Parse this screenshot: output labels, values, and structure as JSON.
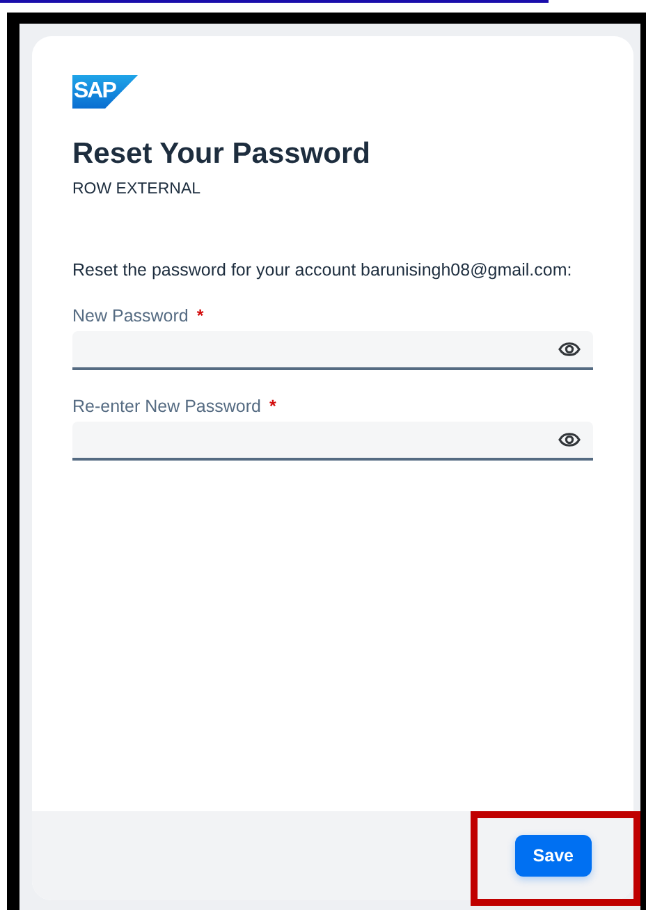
{
  "logo": "SAP",
  "title": "Reset Your Password",
  "subtitle": "ROW EXTERNAL",
  "instruction": "Reset the password for your account barunisingh08@gmail.com:",
  "fields": [
    {
      "label": "New Password",
      "required_mark": "*"
    },
    {
      "label": "Re-enter New Password",
      "required_mark": "*"
    }
  ],
  "buttons": [
    {
      "label": "Save",
      "highlighted": true
    }
  ]
}
